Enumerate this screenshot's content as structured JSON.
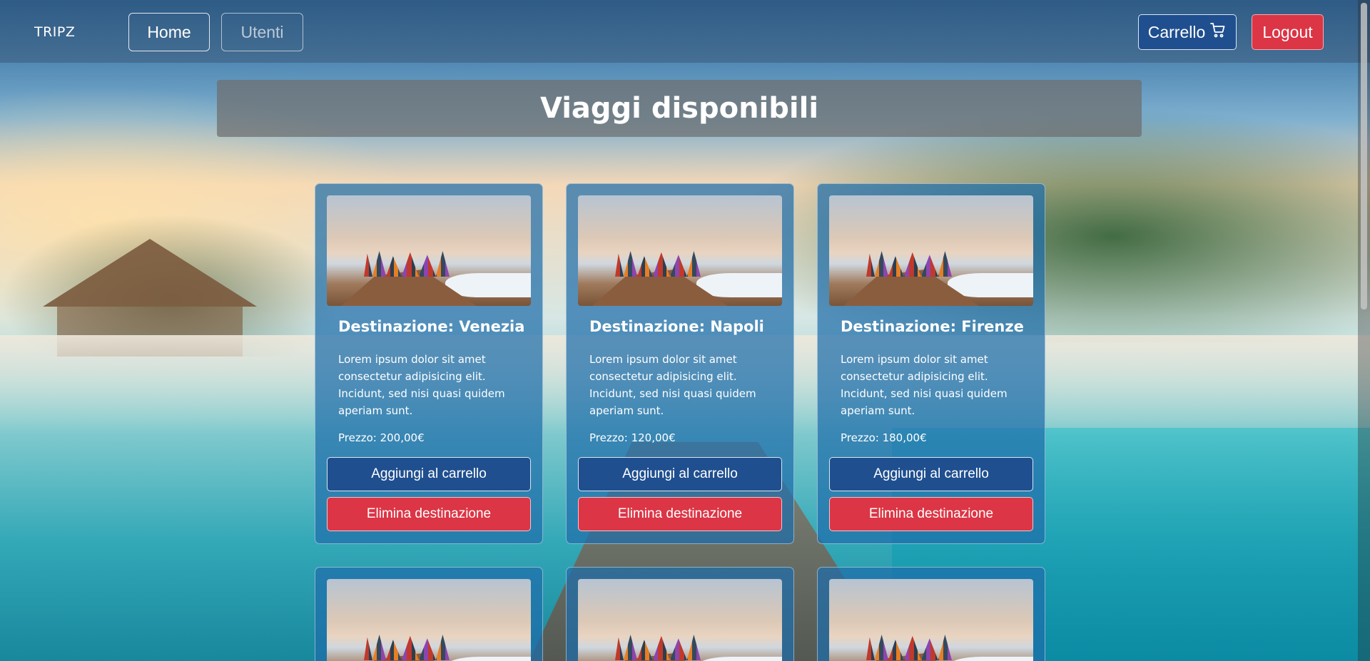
{
  "navbar": {
    "brand": "TRIPZ",
    "home_label": "Home",
    "utenti_label": "Utenti",
    "carrello_label": "Carrello",
    "carrello_icon": "cart-icon",
    "logout_label": "Logout"
  },
  "page": {
    "title": "Viaggi disponibili"
  },
  "cards": [
    {
      "title": "Destinazione: Venezia",
      "text": "Lorem ipsum dolor sit amet consectetur adipisicing elit. Incidunt, sed nisi quasi quidem aperiam sunt.",
      "price": "Prezzo: 200,00€",
      "add_label": "Aggiungi al carrello",
      "delete_label": "Elimina destinazione"
    },
    {
      "title": "Destinazione: Napoli",
      "text": "Lorem ipsum dolor sit amet consectetur adipisicing elit. Incidunt, sed nisi quasi quidem aperiam sunt.",
      "price": "Prezzo: 120,00€",
      "add_label": "Aggiungi al carrello",
      "delete_label": "Elimina destinazione"
    },
    {
      "title": "Destinazione: Firenze",
      "text": "Lorem ipsum dolor sit amet consectetur adipisicing elit. Incidunt, sed nisi quasi quidem aperiam sunt.",
      "price": "Prezzo: 180,00€",
      "add_label": "Aggiungi al carrello",
      "delete_label": "Elimina destinazione"
    }
  ],
  "colors": {
    "primary": "#1f4f8f",
    "danger": "#dc3545",
    "card_bg": "rgba(30,110,170,0.72)"
  }
}
